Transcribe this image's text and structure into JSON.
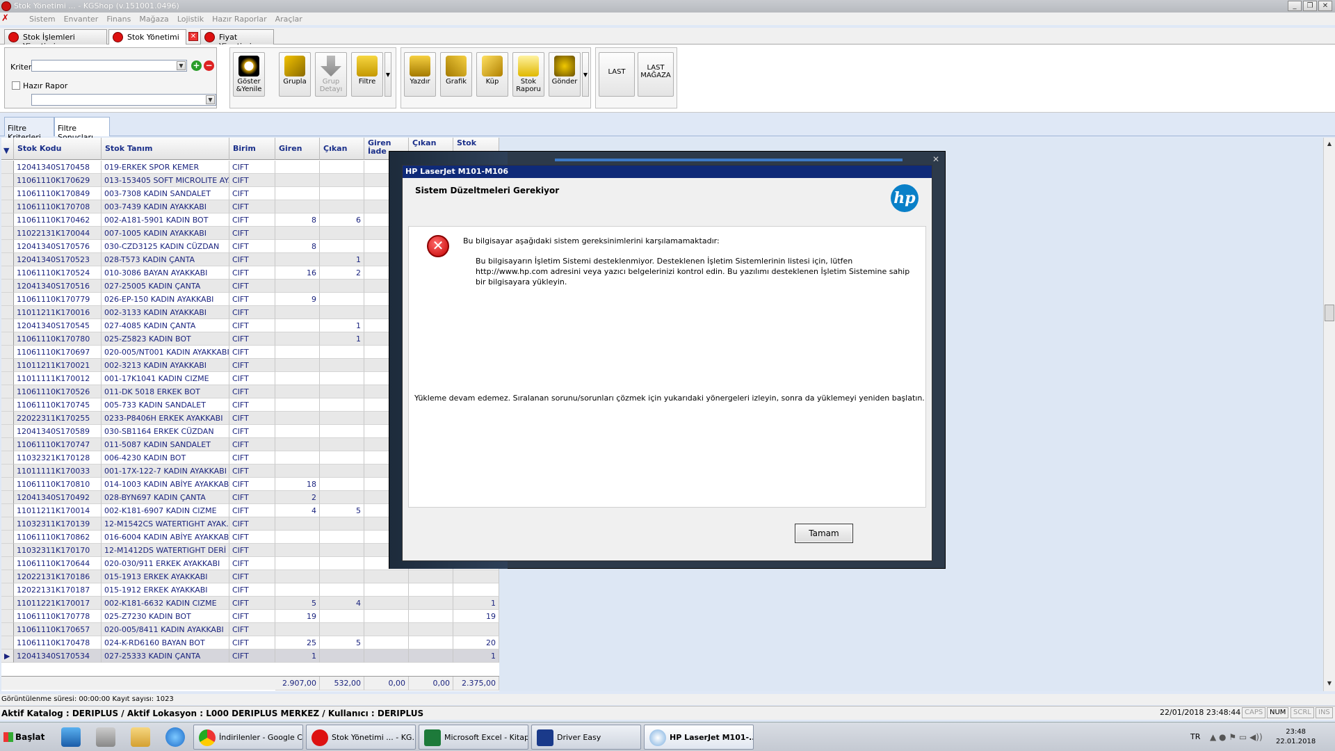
{
  "window": {
    "title": "Stok Yönetimi ... - KGShop (v.151001.0496)"
  },
  "menu": [
    "Sistem",
    "Envanter",
    "Finans",
    "Mağaza",
    "Lojistik",
    "Hazır Raporlar",
    "Araçlar"
  ],
  "doc_tabs": [
    {
      "label": "Stok İşlemleri Yönetimi ..."
    },
    {
      "label": "Stok Yönetimi ..."
    },
    {
      "label": "Fiyat Yönetimi ..."
    }
  ],
  "criteria": {
    "kriter_label": "Kriter",
    "kriter_value": "",
    "hazir_rapor_label": "Hazır Rapor",
    "hazir_rapor_value": ""
  },
  "toolbar": {
    "goster": "Göster\n&Yenile",
    "grupla": "Grupla",
    "grup_detayi": "Grup\nDetayı",
    "filtre": "Filtre",
    "yazdir": "Yazdır",
    "grafik": "Grafik",
    "kup": "Küp",
    "stok_raporu": "Stok\nRaporu",
    "gonder": "Gönder",
    "last": "LAST",
    "last_magaza": "LAST\nMAĞAZA"
  },
  "filter_tabs": [
    "Filtre Kriterleri",
    "Filtre Sonuçları"
  ],
  "grid": {
    "columns": [
      "Stok Kodu",
      "Stok Tanım",
      "Birim",
      "Giren",
      "Çıkan",
      "Giren İade",
      "Çıkan",
      "Stok"
    ],
    "rows": [
      [
        "12041340S170458",
        "019-ERKEK SPOR  KEMER",
        "CIFT",
        "",
        "",
        "",
        "",
        ""
      ],
      [
        "11061110K170629",
        "013-153405 SOFT MICROLITE AYA...",
        "CIFT",
        "",
        "",
        "",
        "",
        ""
      ],
      [
        "11061110K170849",
        "003-7308 KADIN SANDALET",
        "CIFT",
        "",
        "",
        "",
        "",
        ""
      ],
      [
        "11061110K170708",
        "003-7439 KADIN AYAKKABI",
        "CIFT",
        "",
        "",
        "",
        "",
        ""
      ],
      [
        "11061110K170462",
        "002-A181-5901 KADIN BOT",
        "CIFT",
        "8",
        "6",
        "",
        "",
        ""
      ],
      [
        "11022131K170044",
        "007-1005 KADIN AYAKKABI",
        "CIFT",
        "",
        "",
        "",
        "",
        ""
      ],
      [
        "12041340S170576",
        "030-CZD3125 KADIN CÜZDAN",
        "CIFT",
        "8",
        "",
        "",
        "",
        ""
      ],
      [
        "12041340S170523",
        "028-T573 KADIN ÇANTA",
        "CIFT",
        "",
        "1",
        "",
        "",
        ""
      ],
      [
        "11061110K170524",
        "010-3086 BAYAN AYAKKABI",
        "CIFT",
        "16",
        "2",
        "",
        "",
        ""
      ],
      [
        "12041340S170516",
        "027-25005 KADIN ÇANTA",
        "CIFT",
        "",
        "",
        "",
        "",
        ""
      ],
      [
        "11061110K170779",
        "026-EP-150 KADIN AYAKKABI",
        "CIFT",
        "9",
        "",
        "",
        "",
        ""
      ],
      [
        "11011211K170016",
        "002-3133 KADIN AYAKKABI",
        "CIFT",
        "",
        "",
        "",
        "",
        ""
      ],
      [
        "12041340S170545",
        "027-4085 KADIN ÇANTA",
        "CIFT",
        "",
        "1",
        "",
        "",
        ""
      ],
      [
        "11061110K170780",
        "025-Z5823 KADIN BOT",
        "CIFT",
        "",
        "1",
        "",
        "",
        ""
      ],
      [
        "11061110K170697",
        "020-005/NT001 KADIN AYAKKABI",
        "CIFT",
        "",
        "",
        "",
        "",
        ""
      ],
      [
        "11011211K170021",
        "002-3213 KADIN AYAKKABI",
        "CIFT",
        "",
        "",
        "",
        "",
        ""
      ],
      [
        "11011111K170012",
        "001-17K1041 KADIN CIZME",
        "CIFT",
        "",
        "",
        "",
        "",
        ""
      ],
      [
        "11061110K170526",
        "011-DK 5018 ERKEK BOT",
        "CIFT",
        "",
        "",
        "",
        "",
        ""
      ],
      [
        "11061110K170745",
        "005-733 KADIN SANDALET",
        "CIFT",
        "",
        "",
        "",
        "",
        ""
      ],
      [
        "22022311K170255",
        "0233-P8406H ERKEK AYAKKABI",
        "CIFT",
        "",
        "",
        "",
        "",
        ""
      ],
      [
        "12041340S170589",
        "030-SB1164 ERKEK CÜZDAN",
        "CIFT",
        "",
        "",
        "",
        "",
        ""
      ],
      [
        "11061110K170747",
        "011-5087 KADIN SANDALET",
        "CIFT",
        "",
        "",
        "",
        "",
        ""
      ],
      [
        "11032321K170128",
        "006-4230 KADIN BOT",
        "CIFT",
        "",
        "",
        "",
        "",
        ""
      ],
      [
        "11011111K170033",
        "001-17X-122-7 KADIN AYAKKABI",
        "CIFT",
        "",
        "",
        "",
        "",
        ""
      ],
      [
        "11061110K170810",
        "014-1003 KADIN ABİYE AYAKKABI",
        "CIFT",
        "18",
        "",
        "",
        "",
        ""
      ],
      [
        "12041340S170492",
        "028-BYN697 KADIN ÇANTA",
        "CIFT",
        "2",
        "",
        "",
        "",
        ""
      ],
      [
        "11011211K170014",
        "002-K181-6907 KADIN CIZME",
        "CIFT",
        "4",
        "5",
        "",
        "",
        ""
      ],
      [
        "11032311K170139",
        "12-M1542CS WATERTIGHT AYAK...",
        "CIFT",
        "",
        "",
        "",
        "",
        ""
      ],
      [
        "11061110K170862",
        "016-6004 KADIN ABİYE AYAKKABI",
        "CIFT",
        "",
        "",
        "",
        "",
        ""
      ],
      [
        "11032311K170170",
        "12-M1412DS WATERTIGHT DERİ ...",
        "CIFT",
        "",
        "",
        "",
        "",
        ""
      ],
      [
        "11061110K170644",
        "020-030/911 ERKEK AYAKKABI",
        "CIFT",
        "",
        "",
        "",
        "",
        ""
      ],
      [
        "12022131K170186",
        "015-1913 ERKEK AYAKKABI",
        "CIFT",
        "",
        "",
        "",
        "",
        ""
      ],
      [
        "12022131K170187",
        "015-1912 ERKEK AYAKKABI",
        "CIFT",
        "",
        "",
        "",
        "",
        ""
      ],
      [
        "11011221K170017",
        "002-K181-6632 KADIN CIZME",
        "CIFT",
        "5",
        "4",
        "",
        "",
        "1"
      ],
      [
        "11061110K170778",
        "025-Z7230 KADIN BOT",
        "CIFT",
        "19",
        "",
        "",
        "",
        "19"
      ],
      [
        "11061110K170657",
        "020-005/8411 KADIN AYAKKABI",
        "CIFT",
        "",
        "",
        "",
        "",
        ""
      ],
      [
        "11061110K170478",
        "024-K-RD6160 BAYAN BOT",
        "CIFT",
        "25",
        "5",
        "",
        "",
        "20"
      ],
      [
        "12041340S170534",
        "027-25333 KADIN ÇANTA",
        "CIFT",
        "1",
        "",
        "",
        "",
        "1"
      ]
    ],
    "totals": [
      "2.907,00",
      "532,00",
      "0,00",
      "0,00",
      "2.375,00"
    ]
  },
  "status": {
    "line1": "Görüntülenme süresi: 00:00:00 Kayıt sayısı: 1023",
    "line2": "Aktif Katalog : DERIPLUS / Aktif Lokasyon : L000 DERIPLUS MERKEZ / Kullanıcı : DERIPLUS",
    "datetime": "22/01/2018 23:48:44",
    "keys": [
      "CAPS",
      "NUM",
      "SCRL",
      "INS"
    ]
  },
  "dialog": {
    "title": "HP LaserJet M101-M106",
    "header": "Sistem Düzeltmeleri Gerekiyor",
    "logo": "hp",
    "message1": "Bu bilgisayar aşağıdaki sistem gereksinimlerini karşılamamaktadır:",
    "message2": "Bu bilgisayarın İşletim Sistemi desteklenmiyor.  Desteklenen İşletim Sistemlerinin listesi için, lütfen http://www.hp.com adresini veya yazıcı belgelerinizi kontrol edin.  Bu yazılımı desteklenen İşletim Sistemine sahip bir bilgisayara yükleyin.",
    "message3": "Yükleme devam edemez.  Sıralanan sorunu/sorunları çözmek için yukarıdaki yönergeleri izleyin, sonra da yüklemeyi yeniden başlatın.",
    "ok": "Tamam"
  },
  "taskbar": {
    "start": "Başlat",
    "tasks": [
      "İndirilenler - Google C...",
      "Stok Yönetimi ... - KG...",
      "Microsoft Excel - Kitap1",
      "Driver Easy",
      "HP LaserJet M101-..."
    ],
    "lang": "TR",
    "time": "23:48",
    "date": "22.01.2018"
  }
}
